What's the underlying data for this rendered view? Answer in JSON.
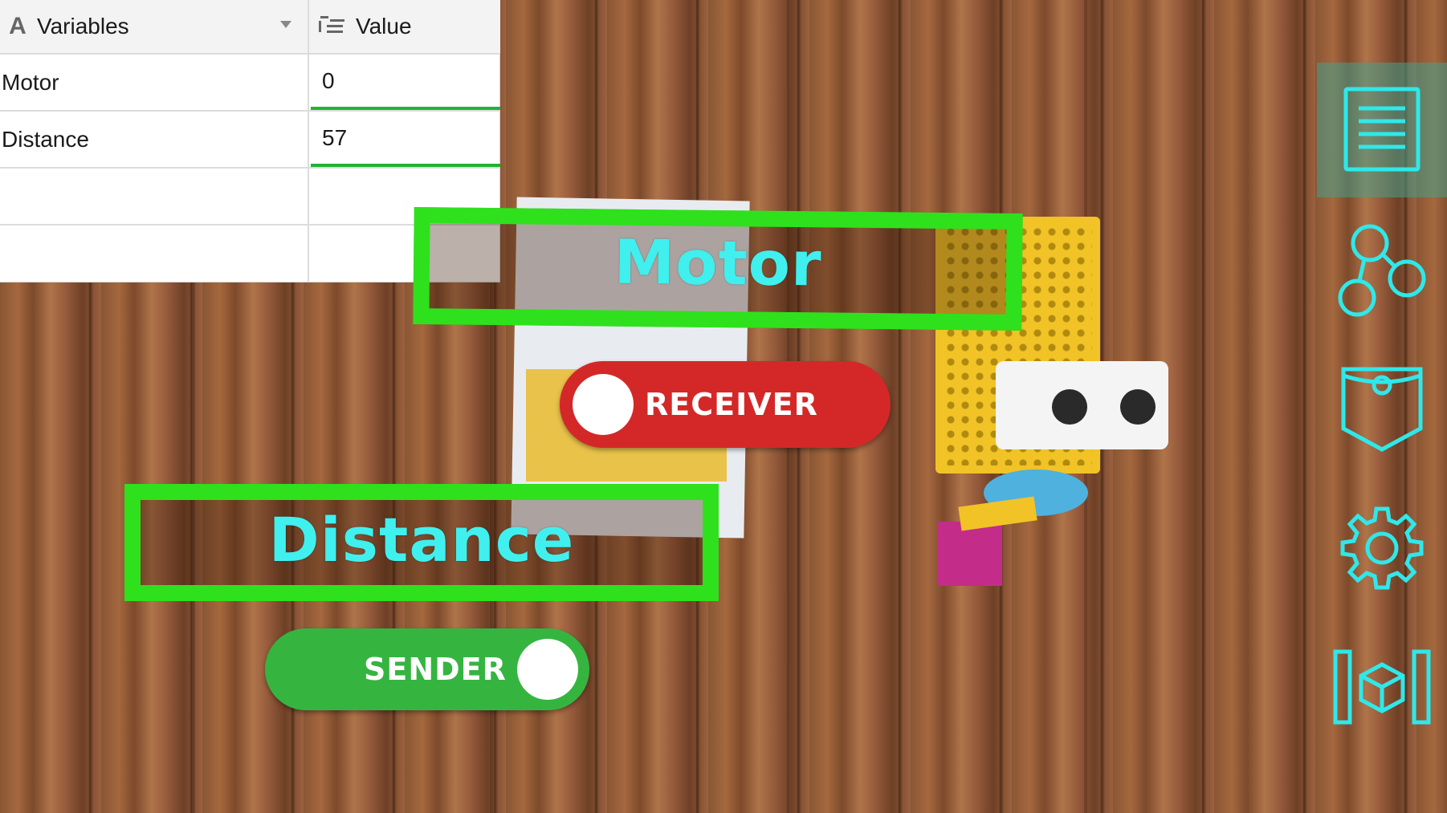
{
  "table": {
    "header": {
      "variables_label": "Variables",
      "value_label": "Value"
    },
    "rows": [
      {
        "name": "Motor",
        "value": "0"
      },
      {
        "name": "Distance",
        "value": "57"
      },
      {
        "name": "",
        "value": ""
      },
      {
        "name": "",
        "value": ""
      }
    ]
  },
  "ar": {
    "motor_label": "Motor",
    "distance_label": "Distance",
    "receiver_label": "RECEIVER",
    "sender_label": "SENDER",
    "receiver_on": false,
    "sender_on": true
  },
  "toolbar": {
    "items": [
      {
        "icon": "list-icon",
        "selected": true
      },
      {
        "icon": "graph-nodes-icon",
        "selected": false
      },
      {
        "icon": "pocket-icon",
        "selected": false
      },
      {
        "icon": "gear-icon",
        "selected": false
      },
      {
        "icon": "cube-icon",
        "selected": false
      }
    ]
  },
  "colors": {
    "ar_green": "#2ee11c",
    "ar_cyan": "#3ff0ee",
    "receiver_red": "#d42828",
    "sender_green": "#35b540",
    "toolbar_cyan": "#2ee8ea"
  }
}
